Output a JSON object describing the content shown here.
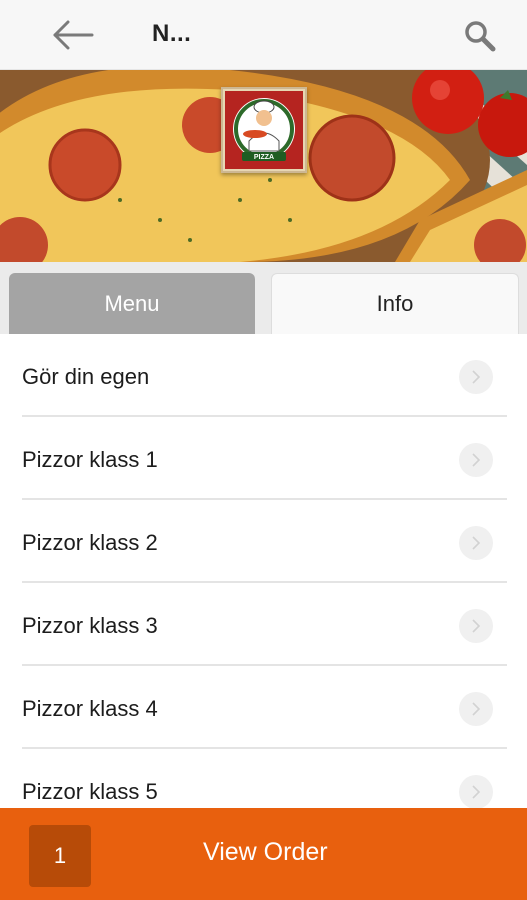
{
  "header": {
    "title": "N...",
    "back_icon": "arrow-left-icon",
    "search_icon": "search-icon"
  },
  "hero": {
    "logo_text": "PIZZA",
    "logo_icon": "pizza-chef-logo"
  },
  "tabs": [
    {
      "label": "Menu",
      "active": true
    },
    {
      "label": "Info",
      "active": false
    }
  ],
  "menu_items": [
    {
      "label": "Gör din egen"
    },
    {
      "label": "Pizzor klass 1"
    },
    {
      "label": "Pizzor klass 2"
    },
    {
      "label": "Pizzor klass 3"
    },
    {
      "label": "Pizzor klass 4"
    },
    {
      "label": "Pizzor klass 5"
    }
  ],
  "order_bar": {
    "count": "1",
    "label": "View Order"
  },
  "colors": {
    "accent": "#e8600e",
    "badge": "#b74b08",
    "tab_active": "#a4a4a4"
  }
}
